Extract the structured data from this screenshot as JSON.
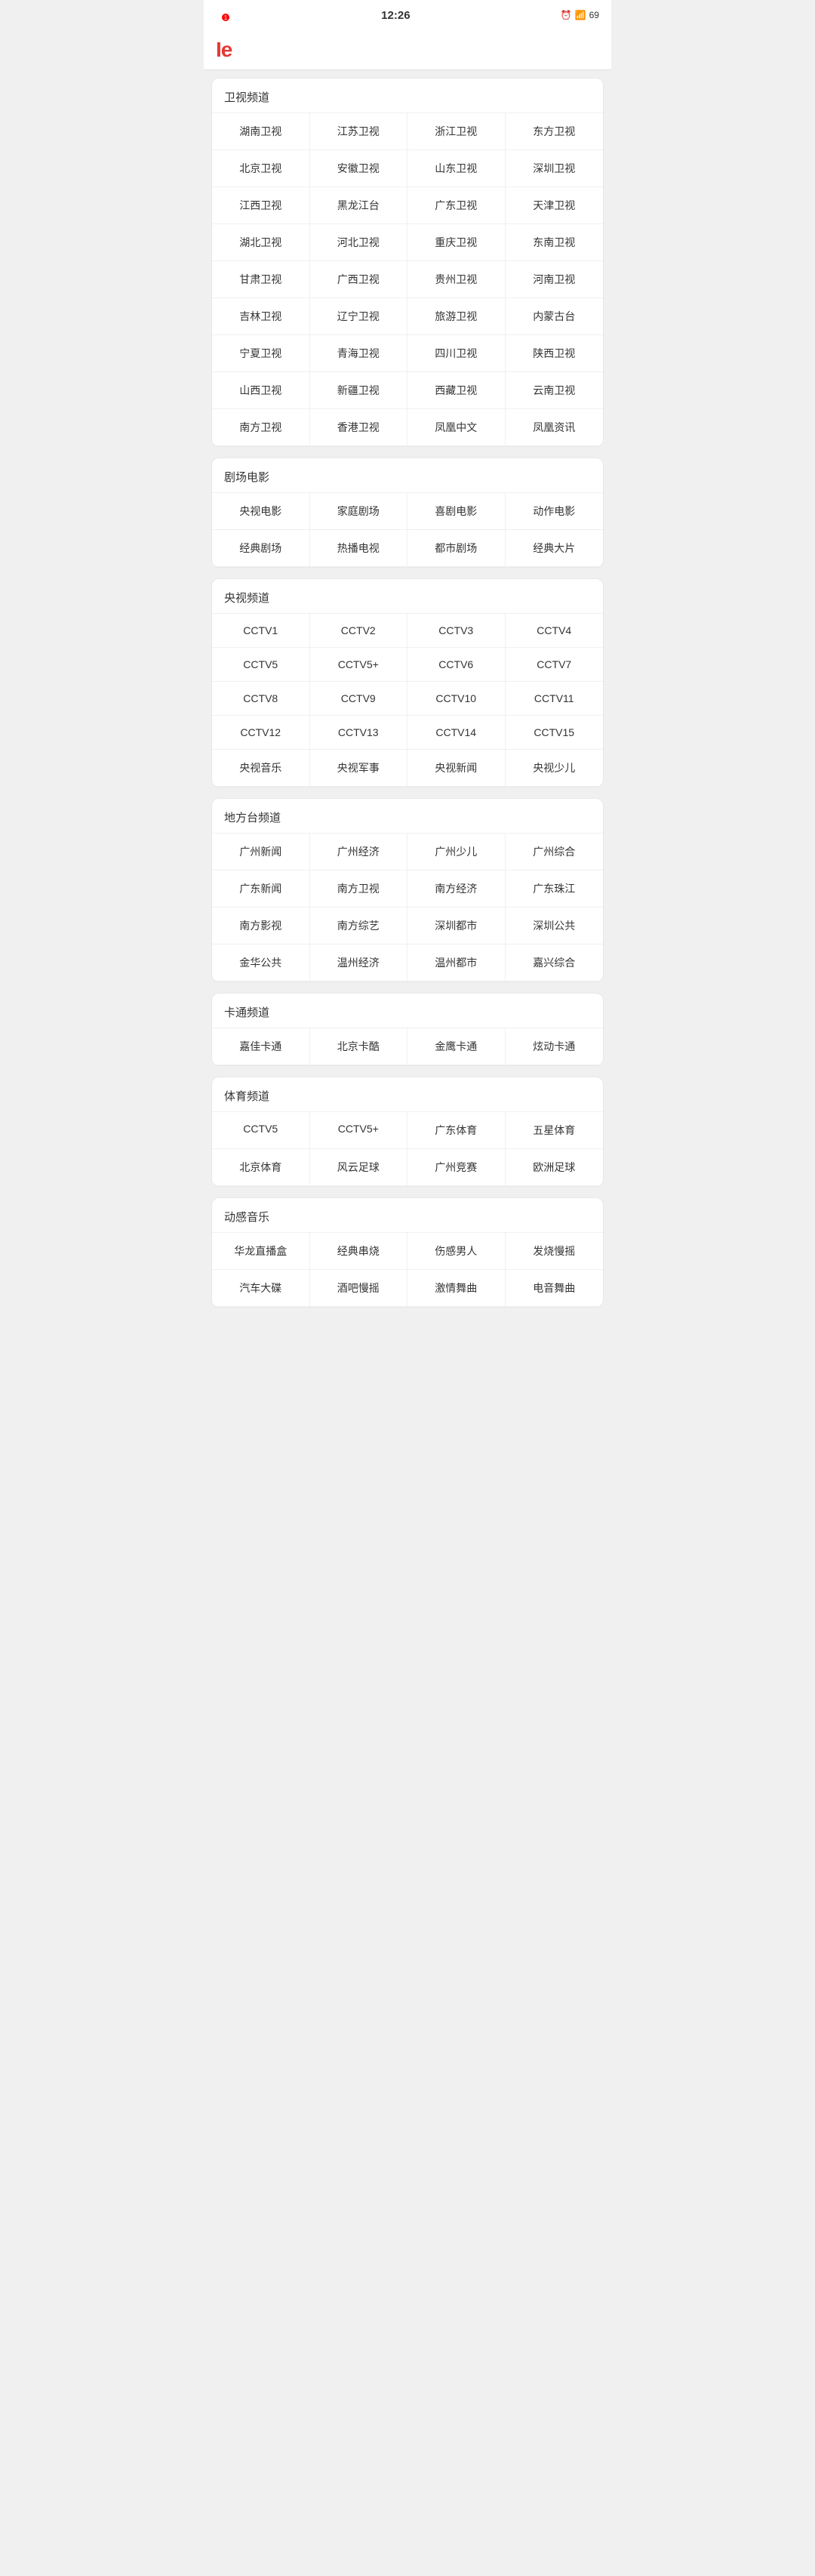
{
  "statusBar": {
    "time": "12:26",
    "notification": "1"
  },
  "header": {
    "logo": "Ie"
  },
  "sections": [
    {
      "id": "satellite",
      "title": "卫视频道",
      "channels": [
        "湖南卫视",
        "江苏卫视",
        "浙江卫视",
        "东方卫视",
        "北京卫视",
        "安徽卫视",
        "山东卫视",
        "深圳卫视",
        "江西卫视",
        "黑龙江台",
        "广东卫视",
        "天津卫视",
        "湖北卫视",
        "河北卫视",
        "重庆卫视",
        "东南卫视",
        "甘肃卫视",
        "广西卫视",
        "贵州卫视",
        "河南卫视",
        "吉林卫视",
        "辽宁卫视",
        "旅游卫视",
        "内蒙古台",
        "宁夏卫视",
        "青海卫视",
        "四川卫视",
        "陕西卫视",
        "山西卫视",
        "新疆卫视",
        "西藏卫视",
        "云南卫视",
        "南方卫视",
        "香港卫视",
        "凤凰中文",
        "凤凰资讯"
      ]
    },
    {
      "id": "theater",
      "title": "剧场电影",
      "channels": [
        "央视电影",
        "家庭剧场",
        "喜剧电影",
        "动作电影",
        "经典剧场",
        "热播电视",
        "都市剧场",
        "经典大片"
      ]
    },
    {
      "id": "cctv",
      "title": "央视频道",
      "channels": [
        "CCTV1",
        "CCTV2",
        "CCTV3",
        "CCTV4",
        "CCTV5",
        "CCTV5+",
        "CCTV6",
        "CCTV7",
        "CCTV8",
        "CCTV9",
        "CCTV10",
        "CCTV11",
        "CCTV12",
        "CCTV13",
        "CCTV14",
        "CCTV15",
        "央视音乐",
        "央视军事",
        "央视新闻",
        "央视少儿"
      ]
    },
    {
      "id": "local",
      "title": "地方台频道",
      "channels": [
        "广州新闻",
        "广州经济",
        "广州少儿",
        "广州综合",
        "广东新闻",
        "南方卫视",
        "南方经济",
        "广东珠江",
        "南方影视",
        "南方综艺",
        "深圳都市",
        "深圳公共",
        "金华公共",
        "温州经济",
        "温州都市",
        "嘉兴综合"
      ]
    },
    {
      "id": "cartoon",
      "title": "卡通频道",
      "channels": [
        "嘉佳卡通",
        "北京卡酷",
        "金鹰卡通",
        "炫动卡通"
      ]
    },
    {
      "id": "sports",
      "title": "体育频道",
      "channels": [
        "CCTV5",
        "CCTV5+",
        "广东体育",
        "五星体育",
        "北京体育",
        "风云足球",
        "广州竞赛",
        "欧洲足球"
      ]
    },
    {
      "id": "music",
      "title": "动感音乐",
      "channels": [
        "华龙直播盒",
        "经典串烧",
        "伤感男人",
        "发烧慢摇",
        "汽车大碟",
        "酒吧慢摇",
        "激情舞曲",
        "电音舞曲"
      ]
    }
  ]
}
